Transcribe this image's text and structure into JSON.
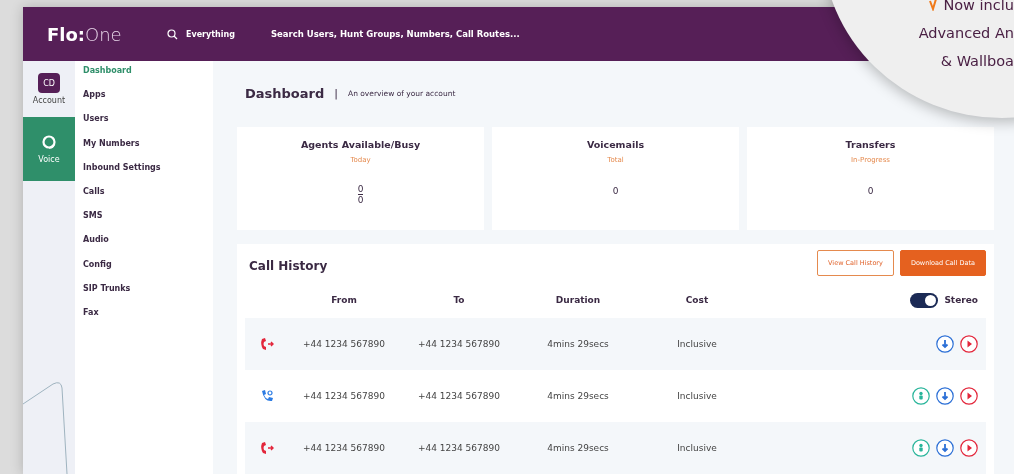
{
  "topbar": {
    "logo_bold": "Flo:",
    "logo_light": "One",
    "search_scope": "Everything",
    "search_placeholder": "Search Users, Hunt Groups, Numbers, Call Routes..."
  },
  "rail": [
    {
      "label": "Account",
      "badge": "CD",
      "kind": "account",
      "selected": false
    },
    {
      "label": "Voice",
      "kind": "voice",
      "selected": true
    }
  ],
  "sidebar": {
    "items": [
      {
        "label": "Dashboard",
        "selected": true
      },
      {
        "label": "Apps",
        "selected": false
      },
      {
        "label": "Users",
        "selected": false
      },
      {
        "label": "My Numbers",
        "selected": false
      },
      {
        "label": "Inbound Settings",
        "selected": false
      },
      {
        "label": "Calls",
        "selected": false
      },
      {
        "label": "SMS",
        "selected": false
      },
      {
        "label": "Audio",
        "selected": false
      },
      {
        "label": "Config",
        "selected": false
      },
      {
        "label": "SIP Trunks",
        "selected": false
      },
      {
        "label": "Fax",
        "selected": false
      }
    ]
  },
  "page": {
    "title": "Dashboard",
    "separator": "|",
    "subtitle": "An overview of your account"
  },
  "cards": [
    {
      "title": "Agents Available/Busy",
      "period": "Today",
      "kind": "fraction",
      "numerator": "0",
      "denominator": "0"
    },
    {
      "title": "Voicemails",
      "period": "Total",
      "kind": "single",
      "value": "0"
    },
    {
      "title": "Transfers",
      "period": "In-Progress",
      "kind": "single",
      "value": "0"
    }
  ],
  "call_history": {
    "title": "Call History",
    "buttons": [
      {
        "label": "View Call History",
        "kind": "outline"
      },
      {
        "label": "Download Call Data",
        "kind": "filled"
      }
    ],
    "columns": [
      "From",
      "To",
      "Duration",
      "Cost"
    ],
    "stereo": {
      "label": "Stereo",
      "on": true
    },
    "rows": [
      {
        "kind": "outbound",
        "from": "+44 1234 567890",
        "to": "+44 1234 567890",
        "duration": "4mins 29secs",
        "cost": "Inclusive",
        "actions": [
          {
            "kind": "download"
          },
          {
            "kind": "play"
          }
        ]
      },
      {
        "kind": "inbound",
        "from": "+44 1234 567890",
        "to": "+44 1234 567890",
        "duration": "4mins 29secs",
        "cost": "Inclusive",
        "actions": [
          {
            "kind": "user"
          },
          {
            "kind": "download"
          },
          {
            "kind": "play"
          }
        ]
      },
      {
        "kind": "outbound",
        "from": "+44 1234 567890",
        "to": "+44 1234 567890",
        "duration": "4mins 29secs",
        "cost": "Inclusive",
        "actions": [
          {
            "kind": "user"
          },
          {
            "kind": "download"
          },
          {
            "kind": "play"
          }
        ]
      }
    ]
  },
  "promo": {
    "lines": [
      "Now inclu",
      "Advanced An",
      "& Wallboa"
    ]
  }
}
